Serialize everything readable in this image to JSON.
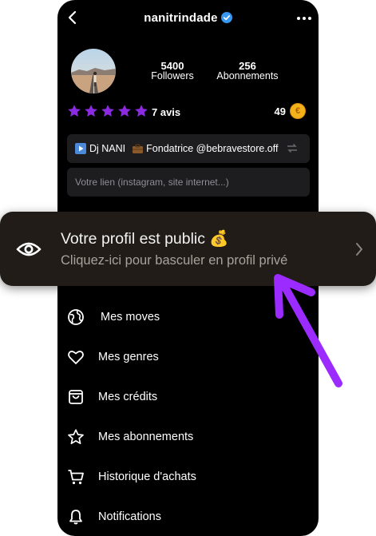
{
  "header": {
    "username": "nanitrindade",
    "back_icon": "chevron-left-icon",
    "more_icon": "more-dots-icon",
    "verified_icon": "verified-badge-icon"
  },
  "profile": {
    "followers_count": "5400",
    "followers_label": "Followers",
    "following_count": "256",
    "following_label": "Abonnements",
    "rating_stars": 5,
    "reviews_label": "7 avis",
    "coins_count": "49",
    "coin_symbol": "€"
  },
  "bio": {
    "part1": "Dj NANI",
    "part2": "Fondatrice @bebravestore.off"
  },
  "link_input": {
    "placeholder": "Votre lien (instagram, site internet...)"
  },
  "banner": {
    "title": "Votre profil est public 💰",
    "subtitle": "Cliquez-ici pour basculer en profil privé"
  },
  "menu": {
    "items": [
      {
        "label": "Mes moves",
        "icon": "globe-icon"
      },
      {
        "label": "Mes genres",
        "icon": "heart-icon"
      },
      {
        "label": "Mes crédits",
        "icon": "bag-icon"
      },
      {
        "label": "Mes abonnements",
        "icon": "star-icon"
      },
      {
        "label": "Historique d'achats",
        "icon": "cart-icon"
      },
      {
        "label": "Notifications",
        "icon": "bell-icon"
      }
    ]
  },
  "colors": {
    "accent_purple": "#9b2bff",
    "star_purple": "#8a2be2",
    "coin": "#f3b21a",
    "banner_bg": "#211c17",
    "app_bg": "#000000"
  }
}
